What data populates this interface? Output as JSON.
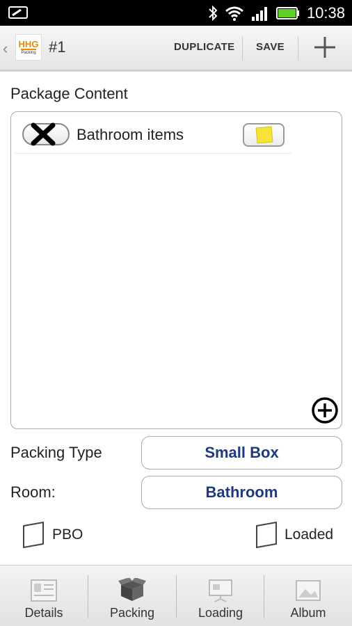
{
  "status_bar": {
    "time": "10:38",
    "icons": [
      "notification-icon",
      "bluetooth-icon",
      "wifi-icon",
      "signal-icon",
      "battery-icon"
    ]
  },
  "action_bar": {
    "title": "#1",
    "logo": {
      "line1": "HHG",
      "line2": "Packing"
    },
    "duplicate_label": "DUPLICATE",
    "save_label": "SAVE",
    "add_icon": "plus-icon"
  },
  "content": {
    "section_title": "Package Content",
    "items": [
      {
        "label": "Bathroom items",
        "toggle_icon": "x-mark-icon",
        "note_icon": "sticky-note-icon"
      }
    ],
    "add_icon": "circle-plus-icon"
  },
  "form": {
    "packing_type_label": "Packing Type",
    "packing_type_value": "Small Box",
    "room_label": "Room:",
    "room_value": "Bathroom",
    "pbo_label": "PBO",
    "pbo_checked": false,
    "loaded_label": "Loaded",
    "loaded_checked": false
  },
  "tabs": [
    {
      "label": "Details",
      "icon": "details-icon"
    },
    {
      "label": "Packing",
      "icon": "box-icon"
    },
    {
      "label": "Loading",
      "icon": "presentation-icon"
    },
    {
      "label": "Album",
      "icon": "image-icon"
    }
  ],
  "colors": {
    "field_text": "#1e3a7a",
    "note_yellow": "#f5e23a",
    "logo_orange": "#f08a00"
  }
}
